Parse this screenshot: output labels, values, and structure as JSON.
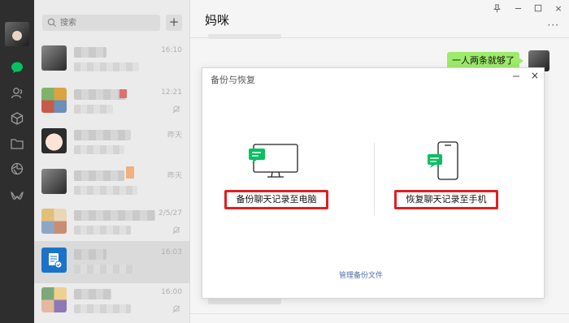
{
  "search": {
    "placeholder": "搜索"
  },
  "list": {
    "add_label": "+",
    "items": [
      {
        "time": "16:10",
        "muted": false
      },
      {
        "time": "12:21",
        "muted": true
      },
      {
        "time": "昨天",
        "muted": false
      },
      {
        "time": "昨天",
        "muted": false
      },
      {
        "time": "2/5/27",
        "muted": true
      },
      {
        "time": "16:03",
        "muted": false
      },
      {
        "time": "16:00",
        "muted": true
      }
    ]
  },
  "chat": {
    "title": "妈咪",
    "messages": [
      {
        "text": "一人两条就够了",
        "from": "self"
      }
    ]
  },
  "dialog": {
    "title": "备份与恢复",
    "close_icon": "×",
    "backup_label": "备份聊天记录至电脑",
    "restore_label": "恢复聊天记录至手机",
    "manage_label": "管理备份文件"
  },
  "window": {
    "pin_icon": "pin-icon",
    "minimize_icon": "minimize-icon",
    "maximize_icon": "maximize-icon",
    "close_icon": "×",
    "more_icon": "···"
  },
  "colors": {
    "nav_bg": "#2e2e2e",
    "accent_green": "#07c160",
    "bubble_green": "#9eea6a",
    "highlight_red": "#e02020",
    "link_blue": "#4a6fa5"
  }
}
